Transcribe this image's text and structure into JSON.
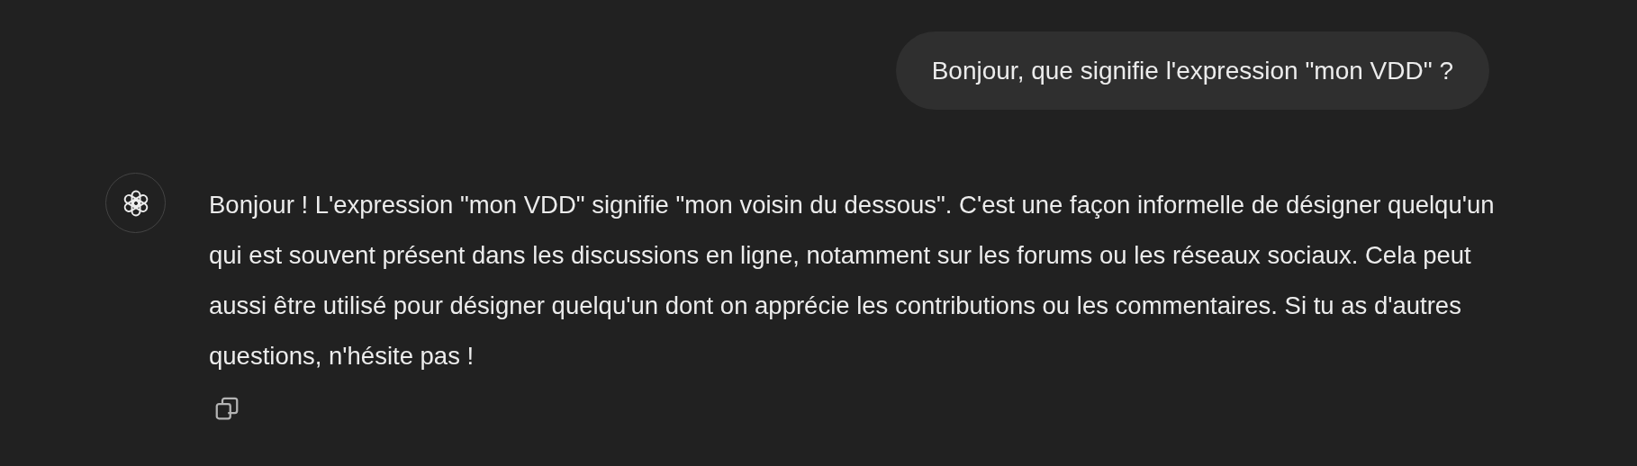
{
  "user_message": {
    "text": "Bonjour, que signifie l'expression \"mon VDD\" ?"
  },
  "assistant_message": {
    "text": "Bonjour ! L'expression \"mon VDD\" signifie \"mon voisin du dessous\". C'est une façon informelle de désigner quelqu'un qui est souvent présent dans les discussions en ligne, notamment sur les forums ou les réseaux sociaux. Cela peut aussi être utilisé pour désigner quelqu'un dont on apprécie les contributions ou les commentaires. Si tu as d'autres questions, n'hésite pas !"
  }
}
